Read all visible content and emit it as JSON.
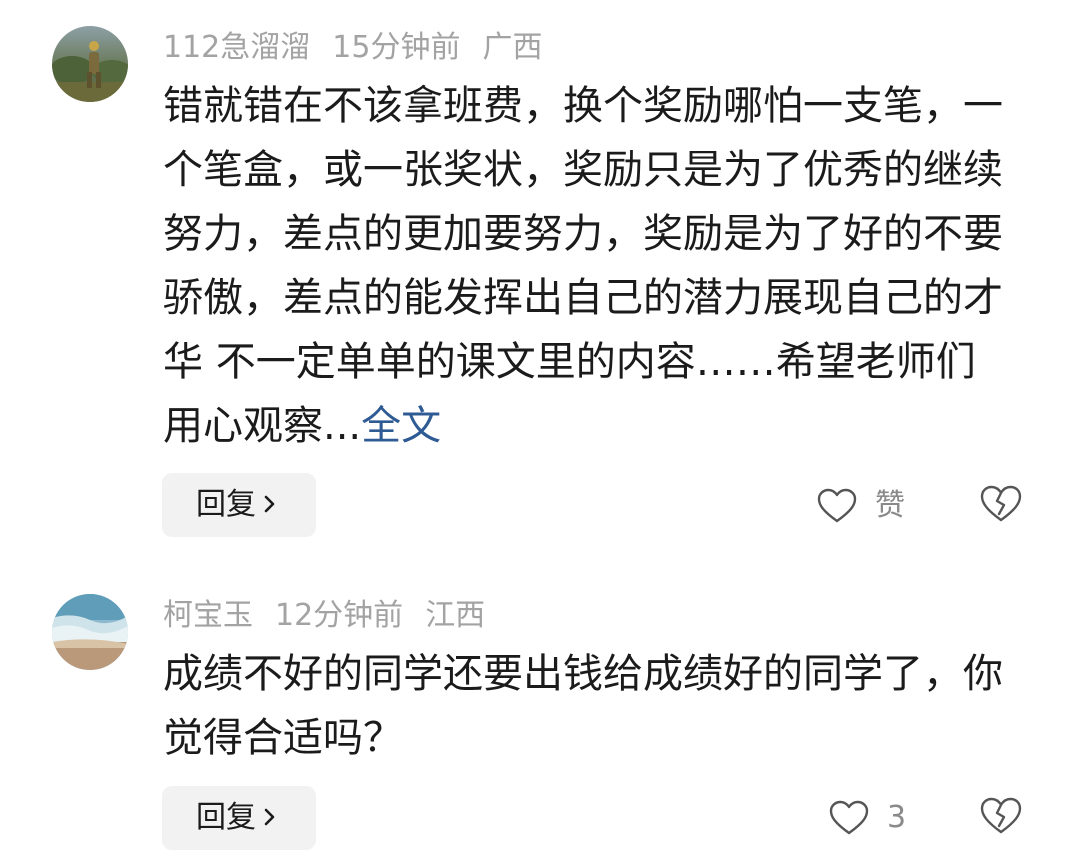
{
  "comments": [
    {
      "username": "112急溜溜",
      "time": "15分钟前",
      "location": "广西",
      "text": "错就错在不该拿班费，换个奖励哪怕一支笔，一个笔盒，或一张奖状，奖励只是为了优秀的继续努力，差点的更加要努力，奖励是为了好的不要骄傲，差点的能发挥出自己的潜力展现自己的才华 不一定单单的课文里的内容……希望老师们用心观察...",
      "more_label": "全文",
      "reply_label": "回复",
      "like_label": "赞"
    },
    {
      "username": "柯宝玉",
      "time": "12分钟前",
      "location": "江西",
      "text": "成绩不好的同学还要出钱给成绩好的同学了，你觉得合适吗？",
      "reply_label": "回复",
      "like_count": "3"
    }
  ],
  "colors": {
    "meta_gray": "#a3a3a3",
    "link_blue": "#2f5b94",
    "reply_bg": "#f2f2f2"
  },
  "icons": {
    "like": "heart-outline-icon",
    "dislike": "broken-heart-icon",
    "reply_arrow": "chevron-right-icon"
  }
}
